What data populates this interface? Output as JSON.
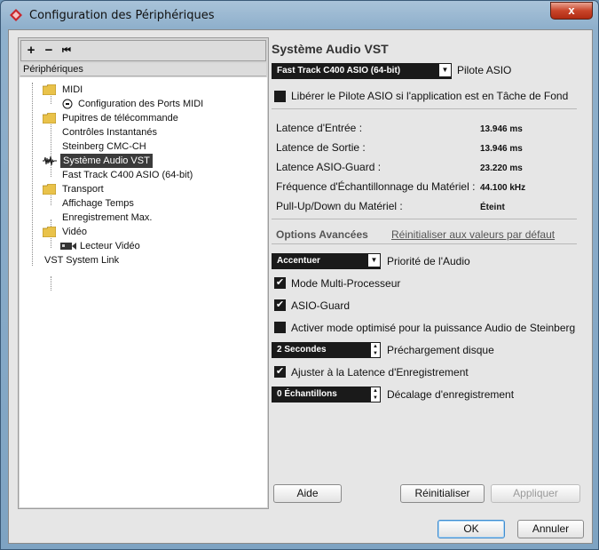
{
  "window": {
    "title": "Configuration des Périphériques",
    "close": "x"
  },
  "toolbar": {
    "add": "+",
    "remove": "−",
    "reset": "⏮"
  },
  "tree": {
    "header": "Périphériques",
    "items": [
      {
        "label": "MIDI",
        "icon": "folder-icon"
      },
      {
        "label": "Configuration des Ports MIDI",
        "icon": "midi-port-icon"
      },
      {
        "label": "Pupitres de télécommande",
        "icon": "folder-icon"
      },
      {
        "label": "Contrôles Instantanés"
      },
      {
        "label": "Steinberg CMC-CH"
      },
      {
        "label": "Système Audio VST",
        "icon": "audio-waveform-icon",
        "selected": true
      },
      {
        "label": "Fast Track C400 ASIO (64-bit)"
      },
      {
        "label": "Transport",
        "icon": "folder-icon"
      },
      {
        "label": "Affichage Temps"
      },
      {
        "label": "Enregistrement Max."
      },
      {
        "label": "Vidéo",
        "icon": "folder-icon"
      },
      {
        "label": "Lecteur Vidéo",
        "icon": "video-icon"
      },
      {
        "label": "VST System Link"
      }
    ]
  },
  "right": {
    "title": "Système Audio VST",
    "driver_select": "Fast Track C400 ASIO (64-bit)",
    "driver_label": "Pilote ASIO",
    "release_driver": "Libérer le Pilote ASIO si l'application est en Tâche de Fond",
    "latency": {
      "input_label": "Latence d'Entrée :",
      "input_value": "13.946 ms",
      "output_label": "Latence de Sortie :",
      "output_value": "13.946 ms",
      "guard_label": "Latence ASIO-Guard :",
      "guard_value": "23.220 ms",
      "freq_label": "Fréquence d'Échantillonnage du Matériel :",
      "freq_value": "44.100 kHz",
      "pull_label": "Pull-Up/Down du Matériel :",
      "pull_value": "Éteint"
    },
    "advanced_tab": "Options Avancées",
    "reset_defaults": "Réinitialiser aux valeurs par défaut",
    "priority_select": "Accentuer",
    "priority_label": "Priorité de l'Audio",
    "multiproc": "Mode Multi-Processeur",
    "multiproc_checked": true,
    "asio_guard": "ASIO-Guard",
    "asio_guard_checked": true,
    "steinberg_mode": "Activer mode optimisé pour la puissance Audio de Steinberg",
    "steinberg_mode_checked": false,
    "preload_value": "2 Secondes",
    "preload_label": "Préchargement disque",
    "adjust_latency": "Ajuster à la Latence d'Enregistrement",
    "adjust_latency_checked": true,
    "offset_value": "0 Échantillons",
    "offset_label": "Décalage d'enregistrement"
  },
  "buttons": {
    "help": "Aide",
    "reset": "Réinitialiser",
    "apply": "Appliquer",
    "ok": "OK",
    "cancel": "Annuler"
  },
  "colors": {
    "accent": "#3f8ccf",
    "selected_row": "#3b3b3b",
    "folder": "#e9c24a"
  }
}
